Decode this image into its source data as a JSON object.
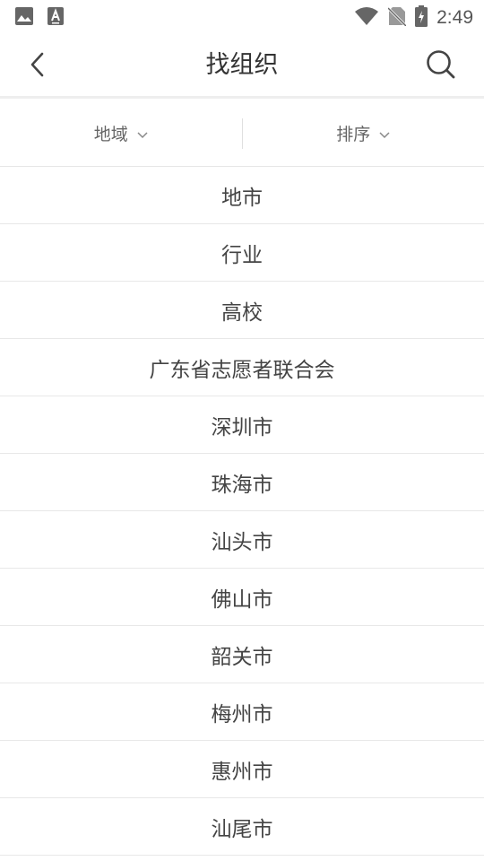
{
  "status_bar": {
    "time": "2:49",
    "icons": [
      "image-icon",
      "font-download-icon",
      "wifi-icon",
      "no-sim-icon",
      "battery-charging-icon"
    ]
  },
  "app_bar": {
    "title": "找组织",
    "back_icon": "chevron-left-icon",
    "search_icon": "search-icon"
  },
  "filters": [
    {
      "label": "地域",
      "icon": "chevron-down-icon"
    },
    {
      "label": "排序",
      "icon": "chevron-down-icon"
    }
  ],
  "org_list": [
    "地市",
    "行业",
    "高校",
    "广东省志愿者联合会",
    "深圳市",
    "珠海市",
    "汕头市",
    "佛山市",
    "韶关市",
    "梅州市",
    "惠州市",
    "汕尾市"
  ],
  "colors": {
    "text_primary": "#333333",
    "text_secondary": "#666666",
    "divider": "#e8e8e8",
    "icon": "#555555"
  }
}
